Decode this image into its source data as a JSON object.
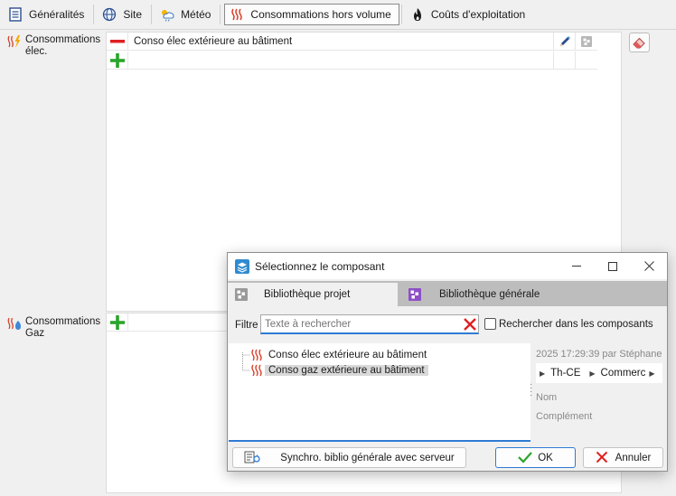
{
  "toolbar": {
    "tabs": [
      {
        "label": "Généralités",
        "icon": "document-list-icon"
      },
      {
        "label": "Site",
        "icon": "globe-icon"
      },
      {
        "label": "Météo",
        "icon": "weather-icon"
      },
      {
        "label": "Consommations hors volume",
        "icon": "heat-waves-icon",
        "active": true
      },
      {
        "label": "Coûts d'exploitation",
        "icon": "flame-icon"
      }
    ]
  },
  "sections": {
    "elec": {
      "label": "Consommations élec.",
      "icon": "heat-lightning-icon"
    },
    "gaz": {
      "label": "Consommations Gaz",
      "icon": "heat-gas-icon"
    }
  },
  "elec_grid": {
    "rows": [
      {
        "text": "Conso élec extérieure au bâtiment"
      }
    ]
  },
  "dialog": {
    "title": "Sélectionnez le composant",
    "tabs": [
      {
        "label": "Bibliothèque projet",
        "active": true
      },
      {
        "label": "Bibliothèque générale",
        "active": false
      }
    ],
    "filter": {
      "label": "Filtre",
      "placeholder": "Texte à rechercher",
      "search_in_components": "Rechercher dans les composants"
    },
    "tree": [
      {
        "label": "Conso élec extérieure au bâtiment",
        "selected": false
      },
      {
        "label": "Conso gaz extérieure au bâtiment",
        "selected": true
      }
    ],
    "properties": {
      "modified": "2025 17:29:39 par Stéphane",
      "breadcrumbs": [
        "Th-CE",
        "Commerc"
      ],
      "name_label": "Nom",
      "complement_label": "Complément"
    },
    "buttons": {
      "sync": "Synchro. biblio générale avec serveur",
      "ok": "OK",
      "cancel": "Annuler"
    }
  },
  "colors": {
    "accent": "#2e7bd4",
    "heat": "#d9412b",
    "add_green": "#2aa52a",
    "remove_red": "#e02020",
    "library_purple": "#8e4fc7"
  }
}
